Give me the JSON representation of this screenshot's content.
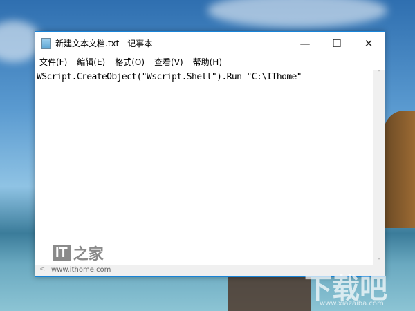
{
  "window": {
    "title": "新建文本文档.txt - 记事本",
    "minimize": "—",
    "maximize": "☐",
    "close": "✕"
  },
  "menu": [
    "文件(F)",
    "编辑(E)",
    "格式(O)",
    "查看(V)",
    "帮助(H)"
  ],
  "editor": {
    "content": "WScript.CreateObject(\"Wscript.Shell\").Run \"C:\\IThome\""
  },
  "scroll": {
    "up": "˄",
    "down": "˅",
    "left": "<"
  },
  "watermarks": {
    "it_logo": "IT",
    "it_cn": "之家",
    "it_url": "www.ithome.com",
    "xz_cn": "下载吧",
    "xz_url": "www.xiazaiba.com"
  }
}
